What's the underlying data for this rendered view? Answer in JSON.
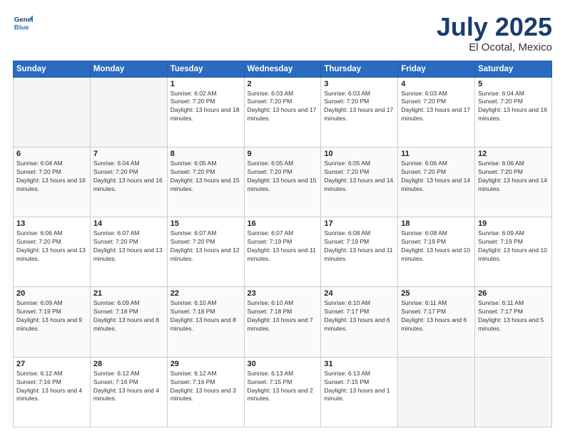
{
  "header": {
    "logo": {
      "line1": "General",
      "line2": "Blue"
    },
    "title": "July 2025",
    "location": "El Ocotal, Mexico"
  },
  "columns": [
    "Sunday",
    "Monday",
    "Tuesday",
    "Wednesday",
    "Thursday",
    "Friday",
    "Saturday"
  ],
  "weeks": [
    [
      {
        "day": "",
        "sunrise": "",
        "sunset": "",
        "daylight": ""
      },
      {
        "day": "",
        "sunrise": "",
        "sunset": "",
        "daylight": ""
      },
      {
        "day": "1",
        "sunrise": "Sunrise: 6:02 AM",
        "sunset": "Sunset: 7:20 PM",
        "daylight": "Daylight: 13 hours and 18 minutes."
      },
      {
        "day": "2",
        "sunrise": "Sunrise: 6:03 AM",
        "sunset": "Sunset: 7:20 PM",
        "daylight": "Daylight: 13 hours and 17 minutes."
      },
      {
        "day": "3",
        "sunrise": "Sunrise: 6:03 AM",
        "sunset": "Sunset: 7:20 PM",
        "daylight": "Daylight: 13 hours and 17 minutes."
      },
      {
        "day": "4",
        "sunrise": "Sunrise: 6:03 AM",
        "sunset": "Sunset: 7:20 PM",
        "daylight": "Daylight: 13 hours and 17 minutes."
      },
      {
        "day": "5",
        "sunrise": "Sunrise: 6:04 AM",
        "sunset": "Sunset: 7:20 PM",
        "daylight": "Daylight: 13 hours and 16 minutes."
      }
    ],
    [
      {
        "day": "6",
        "sunrise": "Sunrise: 6:04 AM",
        "sunset": "Sunset: 7:20 PM",
        "daylight": "Daylight: 13 hours and 16 minutes."
      },
      {
        "day": "7",
        "sunrise": "Sunrise: 6:04 AM",
        "sunset": "Sunset: 7:20 PM",
        "daylight": "Daylight: 13 hours and 16 minutes."
      },
      {
        "day": "8",
        "sunrise": "Sunrise: 6:05 AM",
        "sunset": "Sunset: 7:20 PM",
        "daylight": "Daylight: 13 hours and 15 minutes."
      },
      {
        "day": "9",
        "sunrise": "Sunrise: 6:05 AM",
        "sunset": "Sunset: 7:20 PM",
        "daylight": "Daylight: 13 hours and 15 minutes."
      },
      {
        "day": "10",
        "sunrise": "Sunrise: 6:05 AM",
        "sunset": "Sunset: 7:20 PM",
        "daylight": "Daylight: 13 hours and 14 minutes."
      },
      {
        "day": "11",
        "sunrise": "Sunrise: 6:06 AM",
        "sunset": "Sunset: 7:20 PM",
        "daylight": "Daylight: 13 hours and 14 minutes."
      },
      {
        "day": "12",
        "sunrise": "Sunrise: 6:06 AM",
        "sunset": "Sunset: 7:20 PM",
        "daylight": "Daylight: 13 hours and 14 minutes."
      }
    ],
    [
      {
        "day": "13",
        "sunrise": "Sunrise: 6:06 AM",
        "sunset": "Sunset: 7:20 PM",
        "daylight": "Daylight: 13 hours and 13 minutes."
      },
      {
        "day": "14",
        "sunrise": "Sunrise: 6:07 AM",
        "sunset": "Sunset: 7:20 PM",
        "daylight": "Daylight: 13 hours and 13 minutes."
      },
      {
        "day": "15",
        "sunrise": "Sunrise: 6:07 AM",
        "sunset": "Sunset: 7:20 PM",
        "daylight": "Daylight: 13 hours and 12 minutes."
      },
      {
        "day": "16",
        "sunrise": "Sunrise: 6:07 AM",
        "sunset": "Sunset: 7:19 PM",
        "daylight": "Daylight: 13 hours and 11 minutes."
      },
      {
        "day": "17",
        "sunrise": "Sunrise: 6:08 AM",
        "sunset": "Sunset: 7:19 PM",
        "daylight": "Daylight: 13 hours and 11 minutes."
      },
      {
        "day": "18",
        "sunrise": "Sunrise: 6:08 AM",
        "sunset": "Sunset: 7:19 PM",
        "daylight": "Daylight: 13 hours and 10 minutes."
      },
      {
        "day": "19",
        "sunrise": "Sunrise: 6:09 AM",
        "sunset": "Sunset: 7:19 PM",
        "daylight": "Daylight: 13 hours and 10 minutes."
      }
    ],
    [
      {
        "day": "20",
        "sunrise": "Sunrise: 6:09 AM",
        "sunset": "Sunset: 7:19 PM",
        "daylight": "Daylight: 13 hours and 9 minutes."
      },
      {
        "day": "21",
        "sunrise": "Sunrise: 6:09 AM",
        "sunset": "Sunset: 7:18 PM",
        "daylight": "Daylight: 13 hours and 8 minutes."
      },
      {
        "day": "22",
        "sunrise": "Sunrise: 6:10 AM",
        "sunset": "Sunset: 7:18 PM",
        "daylight": "Daylight: 13 hours and 8 minutes."
      },
      {
        "day": "23",
        "sunrise": "Sunrise: 6:10 AM",
        "sunset": "Sunset: 7:18 PM",
        "daylight": "Daylight: 13 hours and 7 minutes."
      },
      {
        "day": "24",
        "sunrise": "Sunrise: 6:10 AM",
        "sunset": "Sunset: 7:17 PM",
        "daylight": "Daylight: 13 hours and 6 minutes."
      },
      {
        "day": "25",
        "sunrise": "Sunrise: 6:11 AM",
        "sunset": "Sunset: 7:17 PM",
        "daylight": "Daylight: 13 hours and 6 minutes."
      },
      {
        "day": "26",
        "sunrise": "Sunrise: 6:11 AM",
        "sunset": "Sunset: 7:17 PM",
        "daylight": "Daylight: 13 hours and 5 minutes."
      }
    ],
    [
      {
        "day": "27",
        "sunrise": "Sunrise: 6:12 AM",
        "sunset": "Sunset: 7:16 PM",
        "daylight": "Daylight: 13 hours and 4 minutes."
      },
      {
        "day": "28",
        "sunrise": "Sunrise: 6:12 AM",
        "sunset": "Sunset: 7:16 PM",
        "daylight": "Daylight: 13 hours and 4 minutes."
      },
      {
        "day": "29",
        "sunrise": "Sunrise: 6:12 AM",
        "sunset": "Sunset: 7:16 PM",
        "daylight": "Daylight: 13 hours and 3 minutes."
      },
      {
        "day": "30",
        "sunrise": "Sunrise: 6:13 AM",
        "sunset": "Sunset: 7:15 PM",
        "daylight": "Daylight: 13 hours and 2 minutes."
      },
      {
        "day": "31",
        "sunrise": "Sunrise: 6:13 AM",
        "sunset": "Sunset: 7:15 PM",
        "daylight": "Daylight: 13 hours and 1 minute."
      },
      {
        "day": "",
        "sunrise": "",
        "sunset": "",
        "daylight": ""
      },
      {
        "day": "",
        "sunrise": "",
        "sunset": "",
        "daylight": ""
      }
    ]
  ]
}
